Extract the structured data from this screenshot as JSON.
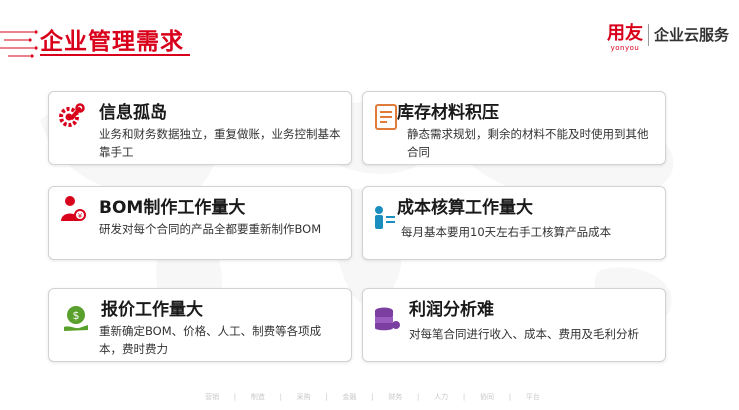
{
  "header": {
    "title": "企业管理需求",
    "logo_cn": "用友",
    "logo_en": "yonyou",
    "logo_service": "企业云服务"
  },
  "cards": [
    {
      "title": "信息孤岛",
      "desc": "业务和财务数据独立，重复做账，业务控制基本靠手工",
      "icon": "gear-wrench-icon"
    },
    {
      "title": "库存材料积压",
      "desc": "静态需求规划，剩余的材料不能及时使用到其他合同",
      "icon": "document-icon"
    },
    {
      "title": "BOM制作工作量大",
      "desc": "研发对每个合同的产品全都要重新制作BOM",
      "icon": "person-coin-icon"
    },
    {
      "title": "成本核算工作量大",
      "desc": "每月基本要用10天左右手工核算产品成本",
      "icon": "person-list-icon"
    },
    {
      "title": "报价工作量大",
      "desc": "重新确定BOM、价格、人工、制费等各项成本，费时费力",
      "icon": "money-hand-icon"
    },
    {
      "title": "利润分析难",
      "desc": "对每笔合同进行收入、成本、费用及毛利分析",
      "icon": "coin-stack-icon"
    }
  ],
  "footer": [
    "营销",
    "制造",
    "采购",
    "金融",
    "财务",
    "人力",
    "协同",
    "平台"
  ],
  "colors": {
    "accent": "#d9001b",
    "purple": "#7b3fa0",
    "green": "#5aa02c"
  }
}
